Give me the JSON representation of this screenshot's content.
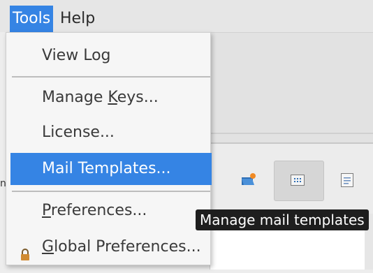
{
  "menubar": {
    "items": [
      {
        "label": "Tools"
      },
      {
        "label": "Help"
      }
    ]
  },
  "tools_menu": {
    "items": [
      {
        "label": "View Log"
      },
      {
        "label_pre": "Manage ",
        "label_ul": "K",
        "label_post": "eys..."
      },
      {
        "label": "License..."
      },
      {
        "label": "Mail Templates..."
      },
      {
        "label_ul": "P",
        "label_post": "references..."
      },
      {
        "label_ul": "G",
        "label_post": "lobal Preferences..."
      }
    ]
  },
  "tooltip": {
    "text": "Manage mail templates"
  },
  "background": {
    "left_edge_glyph": "n"
  },
  "icons": {
    "folder": "folder-open-icon",
    "templates": "mail-templates-icon",
    "document": "document-icon",
    "lock": "lock-icon"
  },
  "colors": {
    "accent": "#3584e4",
    "tooltip_bg": "#1e1e1e"
  }
}
